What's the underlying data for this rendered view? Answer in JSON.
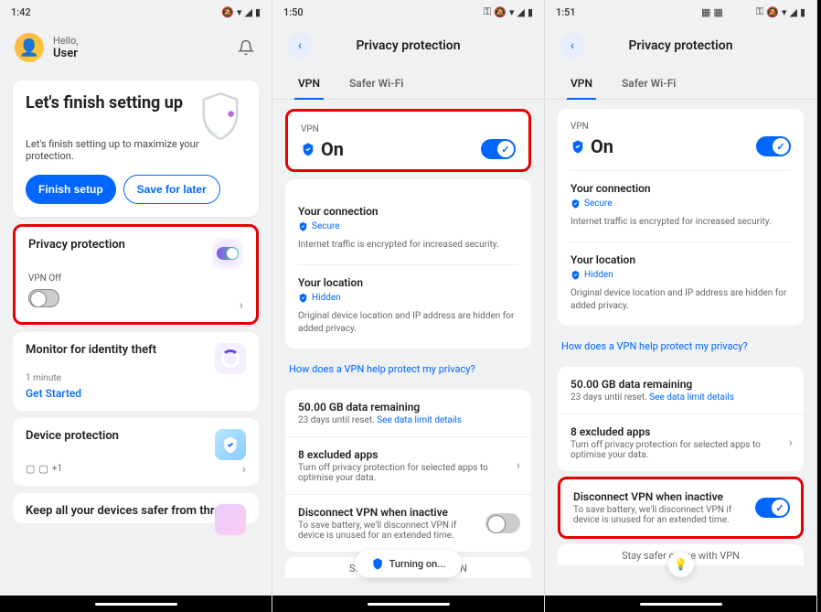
{
  "phone1": {
    "time": "1:42",
    "hello": "Hello,",
    "user": "User",
    "setup": {
      "title": "Let's finish setting up",
      "desc": "Let's finish setting up to maximize your protection.",
      "finish": "Finish setup",
      "later": "Save for later"
    },
    "privacy": {
      "title": "Privacy protection",
      "vpn": "VPN Off"
    },
    "identity": {
      "title": "Monitor for identity theft",
      "sub": "1 minute",
      "link": "Get Started"
    },
    "device": {
      "title": "Device protection",
      "plus": "+1"
    },
    "keep": "Keep all your devices safer from threat"
  },
  "phone2": {
    "time": "1:50",
    "title": "Privacy protection",
    "tabs": {
      "vpn": "VPN",
      "wifi": "Safer Wi-Fi"
    },
    "vpn": {
      "label": "VPN",
      "status": "On"
    },
    "conn": {
      "title": "Your connection",
      "badge": "Secure",
      "desc": "Internet traffic is encrypted for increased security."
    },
    "loc": {
      "title": "Your location",
      "badge": "Hidden",
      "desc": "Original device location and IP address are hidden for added privacy."
    },
    "help": "How does a VPN help protect my privacy?",
    "data": {
      "title": "50.00 GB data remaining",
      "sub": "23 days until reset. ",
      "link": "See data limit details"
    },
    "apps": {
      "title": "8 excluded apps",
      "sub": "Turn off privacy protection for selected apps to optimise your data."
    },
    "disc": {
      "title": "Disconnect VPN when inactive",
      "sub": "To save battery, we'll disconnect VPN if device is unused for an extended time."
    },
    "pill": "Turning on...",
    "footer": "Stay safer online with VPN"
  },
  "phone3": {
    "time": "1:51"
  }
}
